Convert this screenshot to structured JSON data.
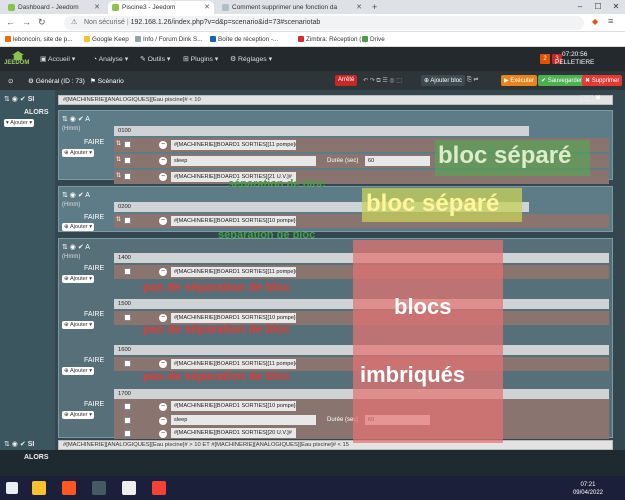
{
  "browser": {
    "tabs": [
      {
        "title": "Dashboard - Jeedom",
        "active": false
      },
      {
        "title": "Piscine3 - Jeedom",
        "active": true
      },
      {
        "title": "Comment supprimer une fonction da",
        "active": false
      }
    ],
    "address": {
      "security": "Non sécurisé",
      "url": "192.168.1.26/index.php?v=d&p=scenario&id=73#scenariotab"
    },
    "bookmarks": [
      "leboncoin, site de p...",
      "Google Keep",
      "Info / Forum Dink S...",
      "Boîte de réception -...",
      "Zimbra: Réception (1)",
      "Drive"
    ]
  },
  "jeedom": {
    "logo": "JEEDOM",
    "menu": [
      "Accueil",
      "Analyse",
      "Outils",
      "Plugins",
      "Réglages"
    ],
    "badges": [
      "2",
      "3"
    ],
    "time": "07:20:56",
    "user": "PELLETIERE"
  },
  "toolbar": {
    "tabs": [
      "Général (ID : 73)",
      "Scénario"
    ],
    "state": "Arrêté",
    "add_block": "Ajouter bloc",
    "execute": "Exécuter",
    "save": "Sauvegarder",
    "delete": "Supprimer"
  },
  "editor": {
    "si": "SI",
    "alors": "ALORS",
    "ajouter": "Ajouter",
    "condition1": "#[MACHINERIE][ANALOGIQUES][Eau piscine]# < 10",
    "condition2": "#[MACHINERIE][ANALOGIQUES][Eau piscine]# > 10 ET #[MACHINERIE][ANALOGIQUES][Eau piscine]# < 15",
    "a": "A",
    "hmm": "(Hmm)",
    "faire": "FAIRE",
    "blocks": [
      {
        "time": "0100",
        "commands": [
          "#[MACHINERIE][BOARD1 SORTIES][11 pompe]#",
          "sleep",
          "#[MACHINERIE][BOARD1 SORTIES][21 U.V.]#"
        ],
        "duree_label": "Durée (sec)",
        "duree": "60"
      },
      {
        "time": "0200",
        "commands": [
          "#[MACHINERIE][BOARD1 SORTIES][10 pompe]#"
        ]
      },
      {
        "time": "1400",
        "commands": [
          "#[MACHINERIE][BOARD1 SORTIES][11 pompe]#"
        ]
      },
      {
        "time": "1500",
        "commands": [
          "#[MACHINERIE][BOARD1 SORTIES][10 pompe]#"
        ]
      },
      {
        "time": "1600",
        "commands": [
          "#[MACHINERIE][BOARD1 SORTIES][11 pompe]#"
        ]
      },
      {
        "time": "1700",
        "commands": [
          "#[MACHINERIE][BOARD1 SORTIES][10 pompe]#",
          "sleep",
          "#[MACHINERIE][BOARD1 SORTIES][20 U.V.]#"
        ],
        "duree_label": "Durée (sec)",
        "duree": "60"
      }
    ]
  },
  "annotations": {
    "bloc_separe": "bloc séparé",
    "separation": "séparation de bloc",
    "pas_separation": "pas de séparation de bloc",
    "blocs": "blocs",
    "imbriques": "imbriqués"
  },
  "taskbar": {
    "time": "07:21",
    "date": "09/04/2022"
  },
  "colors": {
    "execute": "#e8841a",
    "save": "#4caf50",
    "delete": "#e53935",
    "state": "#c62828",
    "annotation_red": "#e53935",
    "annotation_green": "#43a047"
  }
}
